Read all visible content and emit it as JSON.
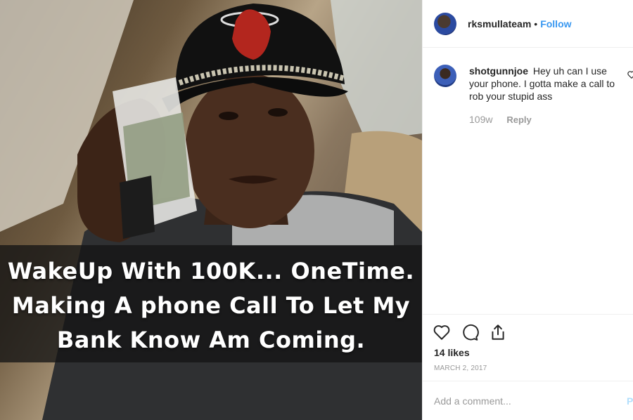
{
  "post": {
    "caption_lines": [
      "WakeUp With 100K... OneTime.",
      "Making A phone Call To Let My",
      "Bank Know Am Coming."
    ]
  },
  "header": {
    "username": "rksmullateam",
    "separator": "•",
    "follow_label": "Follow"
  },
  "comments": [
    {
      "username": "shotgunnjoe",
      "text": "Hey uh can I use your phone. I gotta make a call to rob your stupid ass",
      "time": "109w",
      "reply_label": "Reply"
    }
  ],
  "actions": {
    "icons": [
      "heart-icon",
      "comment-icon",
      "share-icon"
    ],
    "likes": "14 likes",
    "date": "MARCH 2, 2017"
  },
  "add_comment": {
    "placeholder": "Add a comment...",
    "post_label": "Po"
  },
  "colors": {
    "accent": "#3897f0",
    "muted": "#999999",
    "text": "#262626",
    "border": "#efefef"
  }
}
